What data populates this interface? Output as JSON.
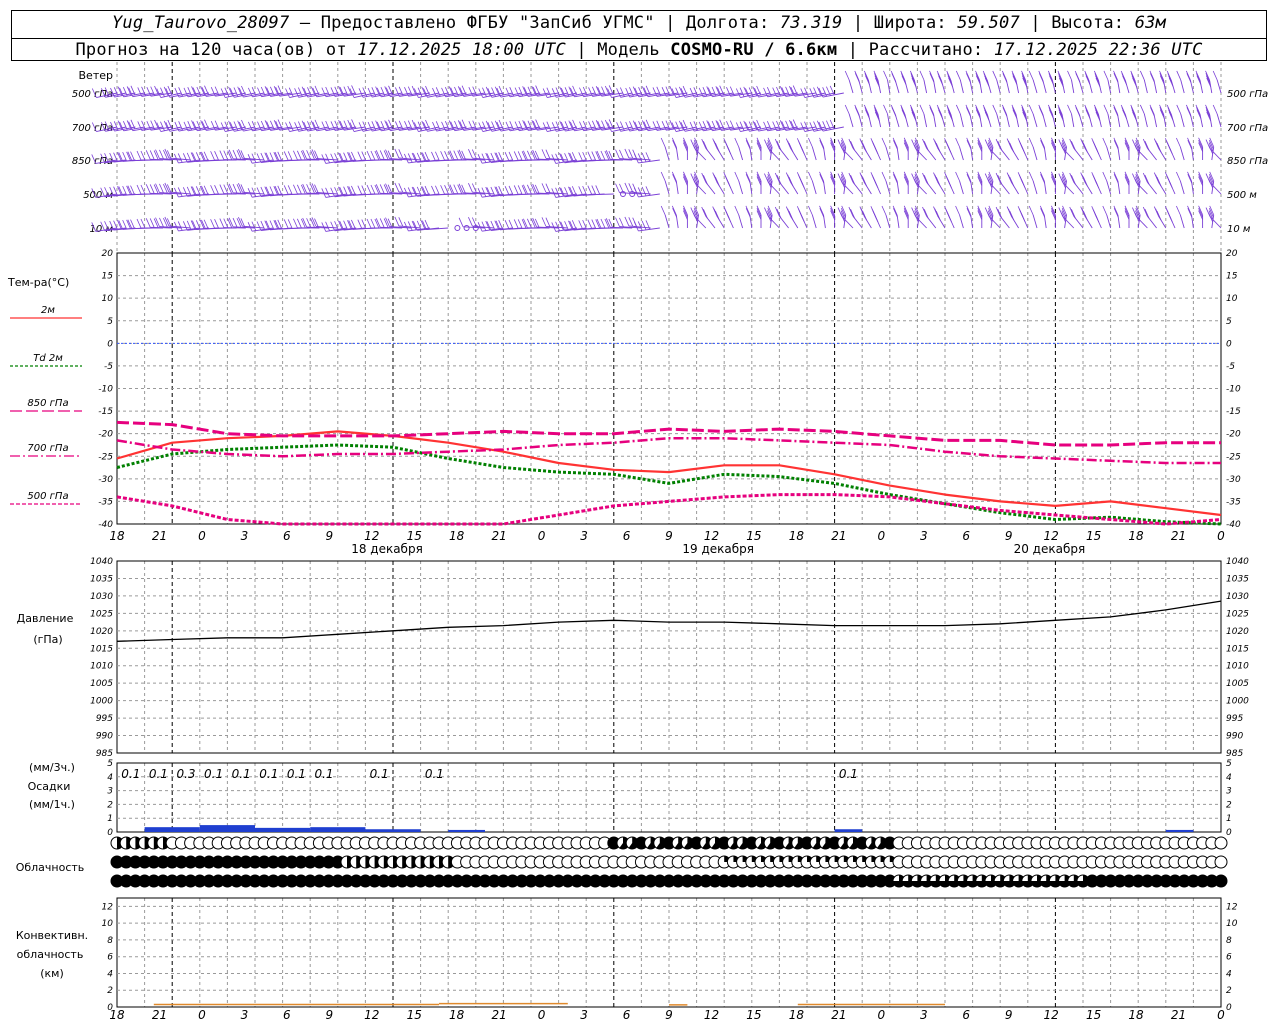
{
  "header": {
    "station": "Yug_Taurovo_28097",
    "provider": "Предоставлено ФГБУ \"ЗапСиб УГМС\"",
    "lon_label": "Долгота:",
    "lon": "73.319",
    "lat_label": "Широта:",
    "lat": "59.507",
    "alt_label": "Высота:",
    "alt": "63м",
    "forecast_label": "Прогноз на 120 часа(ов) от",
    "forecast_start": "17.12.2025 18:00 UTC",
    "model_label": "Модель",
    "model": "COSMO-RU / 6.6км",
    "calc_label": "Рассчитано:",
    "calc_time": "17.12.2025 22:36 UTC"
  },
  "colors": {
    "wind": "#7a3fd6",
    "t2m": "#ff3333",
    "td2m": "#008000",
    "t850": "#e6007e",
    "t700": "#e6007e",
    "t500": "#e6007e",
    "zero_line": "#3355ff",
    "pressure": "#000000",
    "precip": "#1f3fd0",
    "convective": "#e08a2c",
    "grid": "#9a9a9a"
  },
  "labels": {
    "wind_title": "Ветер",
    "wind_levels": [
      "500 гПа",
      "700 гПа",
      "850 гПа",
      "500 м",
      "10 м"
    ],
    "temp_title": "Тем-ра(°С)",
    "legend": [
      {
        "label": "2м",
        "style": "solid"
      },
      {
        "label": "Td 2м",
        "style": "dotted"
      },
      {
        "label": "850 гПа",
        "style": "longdash"
      },
      {
        "label": "700 гПа",
        "style": "dashdot"
      },
      {
        "label": "500 гПа",
        "style": "short-dash"
      }
    ],
    "pressure_title": "Давление",
    "pressure_unit": "(гПа)",
    "precip_unit_3h": "(мм/3ч.)",
    "precip_title": "Осадки",
    "precip_unit_1h": "(мм/1ч.)",
    "cloud_title": "Облачность",
    "conv_title_1": "Конвективн.",
    "conv_title_2": "облачность",
    "conv_unit": "(км)"
  },
  "chart_data": [
    {
      "type": "line",
      "title": "Тем-ра(°С)",
      "x_ticks": [
        "18",
        "21",
        "0",
        "3",
        "6",
        "9",
        "12",
        "15",
        "18",
        "21",
        "0",
        "3",
        "6",
        "9",
        "12",
        "15",
        "18",
        "21",
        "0",
        "3",
        "6",
        "9",
        "12",
        "15",
        "18",
        "21",
        "0"
      ],
      "day_labels": [
        "18 декабря",
        "19 декабря",
        "20 декабря"
      ],
      "x_hours": [
        0,
        6,
        12,
        18,
        24,
        30,
        36,
        42,
        48,
        54,
        60,
        66,
        72,
        78,
        84,
        90,
        96,
        102,
        108,
        114,
        120
      ],
      "ylim": [
        -40,
        20
      ],
      "y_ticks": [
        20,
        15,
        10,
        5,
        0,
        -5,
        -10,
        -15,
        -20,
        -25,
        -30,
        -35,
        -40
      ],
      "series": [
        {
          "name": "2м",
          "values": [
            -25.5,
            -22,
            -21,
            -20.5,
            -19.5,
            -20.5,
            -22,
            -24,
            -26.5,
            -28,
            -28.5,
            -27,
            -27,
            -29,
            -31.5,
            -33.5,
            -35,
            -36,
            -35,
            -36.5,
            -38
          ]
        },
        {
          "name": "Td 2м",
          "values": [
            -27.5,
            -24.5,
            -23.5,
            -23,
            -22.5,
            -23,
            -25.5,
            -27.5,
            -28.5,
            -29,
            -31,
            -29,
            -29.5,
            -31,
            -33.5,
            -35.5,
            -37.5,
            -39,
            -38.5,
            -39.5,
            -40.5
          ]
        },
        {
          "name": "850 гПа",
          "values": [
            -17.5,
            -18,
            -20,
            -20.5,
            -20.5,
            -20.5,
            -20,
            -19.5,
            -20,
            -20,
            -19,
            -19.5,
            -19,
            -19.5,
            -20.5,
            -21.5,
            -21.5,
            -22.5,
            -22.5,
            -22,
            -22
          ]
        },
        {
          "name": "700 гПа",
          "values": [
            -21.5,
            -23.5,
            -24.5,
            -25,
            -24.5,
            -24.5,
            -24,
            -23.5,
            -22.5,
            -22,
            -21,
            -21,
            -21.5,
            -22,
            -22.5,
            -24,
            -25,
            -25.5,
            -26,
            -26.5,
            -26.5
          ]
        },
        {
          "name": "500 гПа",
          "values": [
            -34,
            -36,
            -39,
            -42,
            -43,
            -43.5,
            -42,
            -40,
            -38,
            -36,
            -35,
            -34,
            -33.5,
            -33.5,
            -34,
            -35.5,
            -37,
            -38,
            -39,
            -40,
            -39
          ]
        }
      ]
    },
    {
      "type": "line",
      "title": "Давление",
      "ylabel": "(гПа)",
      "ylim": [
        985,
        1040
      ],
      "y_ticks": [
        1040,
        1035,
        1030,
        1025,
        1020,
        1015,
        1010,
        1005,
        1000,
        995,
        990,
        985
      ],
      "x_hours": [
        0,
        6,
        12,
        18,
        24,
        30,
        36,
        42,
        48,
        54,
        60,
        66,
        72,
        78,
        84,
        90,
        96,
        102,
        108,
        114,
        120
      ],
      "series": [
        {
          "name": "Давление",
          "values": [
            1017,
            1017.5,
            1018,
            1018,
            1019,
            1020,
            1021,
            1021.5,
            1022.5,
            1023,
            1022.5,
            1022.5,
            1022,
            1021.5,
            1021.5,
            1021.5,
            1022,
            1023,
            1024,
            1026,
            1028.5
          ]
        }
      ]
    },
    {
      "type": "bar",
      "title": "Осадки",
      "ylim": [
        0,
        5
      ],
      "y_ticks": [
        5,
        4,
        3,
        2,
        1,
        0
      ],
      "precip_3h_labels": [
        "0.1",
        "0.1",
        "0.3",
        "0.1",
        "0.1",
        "0.1",
        "0.1",
        "0.1",
        "0.1",
        "0.1",
        "0.1"
      ],
      "precip_3h_hours": [
        1.5,
        4.5,
        7.5,
        10.5,
        13.5,
        16.5,
        19.5,
        22.5,
        28.5,
        34.5,
        79.5
      ]
    },
    {
      "type": "area",
      "title": "Конвективн. облачность",
      "ylabel": "(км)",
      "ylim": [
        0,
        13
      ],
      "y_ticks": [
        12,
        10,
        8,
        6,
        4,
        2,
        0
      ]
    }
  ]
}
